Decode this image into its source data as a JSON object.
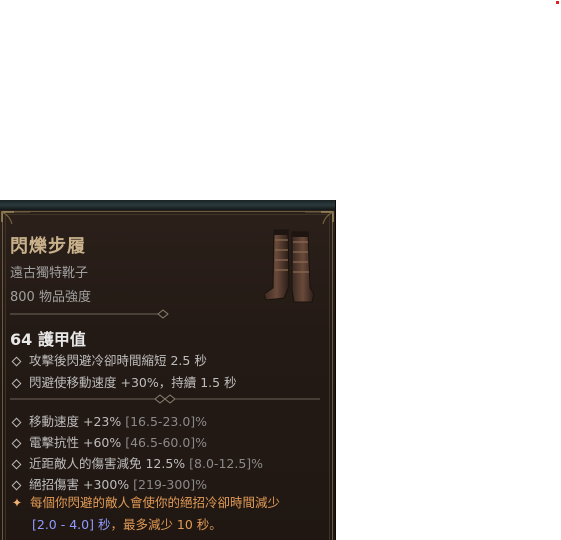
{
  "item": {
    "name": "閃爍步履",
    "type": "遠古獨特靴子",
    "power": "800 物品強度",
    "icon": "boots-icon"
  },
  "armor": {
    "value": "64 護甲值"
  },
  "implicits": [
    {
      "text": "攻擊後閃避冷卻時間縮短 2.5 秒"
    },
    {
      "text": "閃避使移動速度 +30%，持續 1.5 秒"
    }
  ],
  "affixes": [
    {
      "text": "移動速度 +23%",
      "range": "[16.5-23.0]%"
    },
    {
      "text": "電擊抗性 +60%",
      "range": "[46.5-60.0]%"
    },
    {
      "text": "近距敵人的傷害減免 12.5%",
      "range": "[8.0-12.5]%"
    },
    {
      "text": "絕招傷害 +300%",
      "range": "[219-300]%"
    }
  ],
  "legendary": {
    "line1": "每個你閃避的敵人會使你的絕招冷卻時間減少",
    "range": "[2.0 - 4.0] 秒",
    "line2_rest": "，最多減少 10 秒。",
    "icon": "star-icon"
  },
  "colors": {
    "title": "#c9b18b",
    "legendary": "#e09a55",
    "range_highlight": "#8f9aff"
  }
}
